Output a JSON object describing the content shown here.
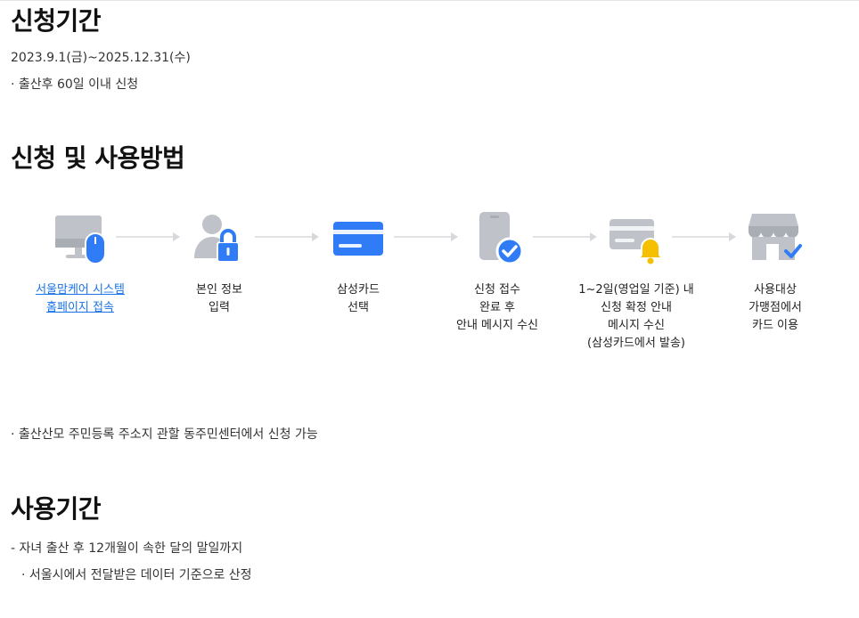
{
  "period": {
    "title": "신청기간",
    "dates": "2023.9.1(금)~2025.12.31(수)",
    "note": "· 출산후 60일 이내 신청"
  },
  "method": {
    "title": "신청 및 사용방법",
    "steps": [
      {
        "lines": [
          "서울맘케어 시스템",
          "홈페이지 접속"
        ],
        "icon": "monitor-mouse-icon"
      },
      {
        "lines": [
          "본인 정보",
          "입력"
        ],
        "icon": "user-lock-icon"
      },
      {
        "lines": [
          "삼성카드",
          "선택"
        ],
        "icon": "credit-card-icon"
      },
      {
        "lines": [
          "신청 접수",
          "완료 후",
          "안내 메시지 수신"
        ],
        "icon": "phone-check-icon"
      },
      {
        "lines": [
          "1~2일(영업일 기준) 내",
          "신청 확정 안내",
          "메시지 수신",
          "(삼성카드에서 발송)"
        ],
        "icon": "card-bell-icon"
      },
      {
        "lines": [
          "사용대상",
          "가맹점에서",
          "카드 이용"
        ],
        "icon": "store-check-icon"
      }
    ],
    "note": "· 출산산모 주민등록 주소지 관할 동주민센터에서 신청 가능"
  },
  "usage": {
    "title": "사용기간",
    "line1": "- 자녀 출산 후 12개월이 속한 달의 말일까지",
    "line2": "· 서울시에서 전달받은 데이터 기준으로 산정"
  },
  "colors": {
    "accent": "#2f7cf6",
    "icon_gray": "#bfc3c9",
    "bell": "#f5c000",
    "link": "#1a73e8"
  }
}
